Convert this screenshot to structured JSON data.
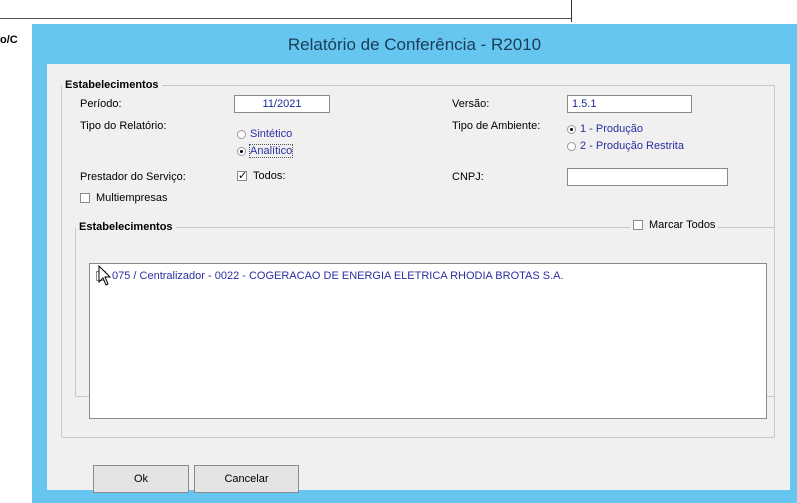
{
  "background": {
    "fragment_label": "o/C"
  },
  "window": {
    "title": "Relatório de Conferência - R2010"
  },
  "form": {
    "group_title": "Estabelecimentos",
    "periodo": {
      "label": "Período:",
      "value": "11/2021"
    },
    "versao": {
      "label": "Versão:",
      "value": "1.5.1"
    },
    "tipo_relatorio": {
      "label": "Tipo do Relatório:",
      "options": [
        {
          "label": "Sintético",
          "selected": false
        },
        {
          "label": "Analítico",
          "selected": true
        }
      ]
    },
    "tipo_ambiente": {
      "label": "Tipo de Ambiente:",
      "options": [
        {
          "label": "1 - Produção",
          "selected": true
        },
        {
          "label": "2 - Produção Restrita",
          "selected": false
        }
      ]
    },
    "prestador": {
      "label": "Prestador do Serviço:",
      "checkbox_label": "Todos:",
      "checked": true
    },
    "cnpj": {
      "label": "CNPJ:",
      "value": ""
    },
    "multiempresas": {
      "label": "Multiempresas",
      "checked": false
    },
    "estabelecimentos": {
      "title": "Estabelecimentos",
      "marcar_todos_label": "Marcar Todos",
      "items": [
        {
          "label": "075 / Centralizador - 0022 - COGERACAO DE ENERGIA ELETRICA RHODIA BROTAS S.A.",
          "checked": false
        }
      ]
    }
  },
  "buttons": {
    "ok": "Ok",
    "cancel": "Cancelar"
  }
}
